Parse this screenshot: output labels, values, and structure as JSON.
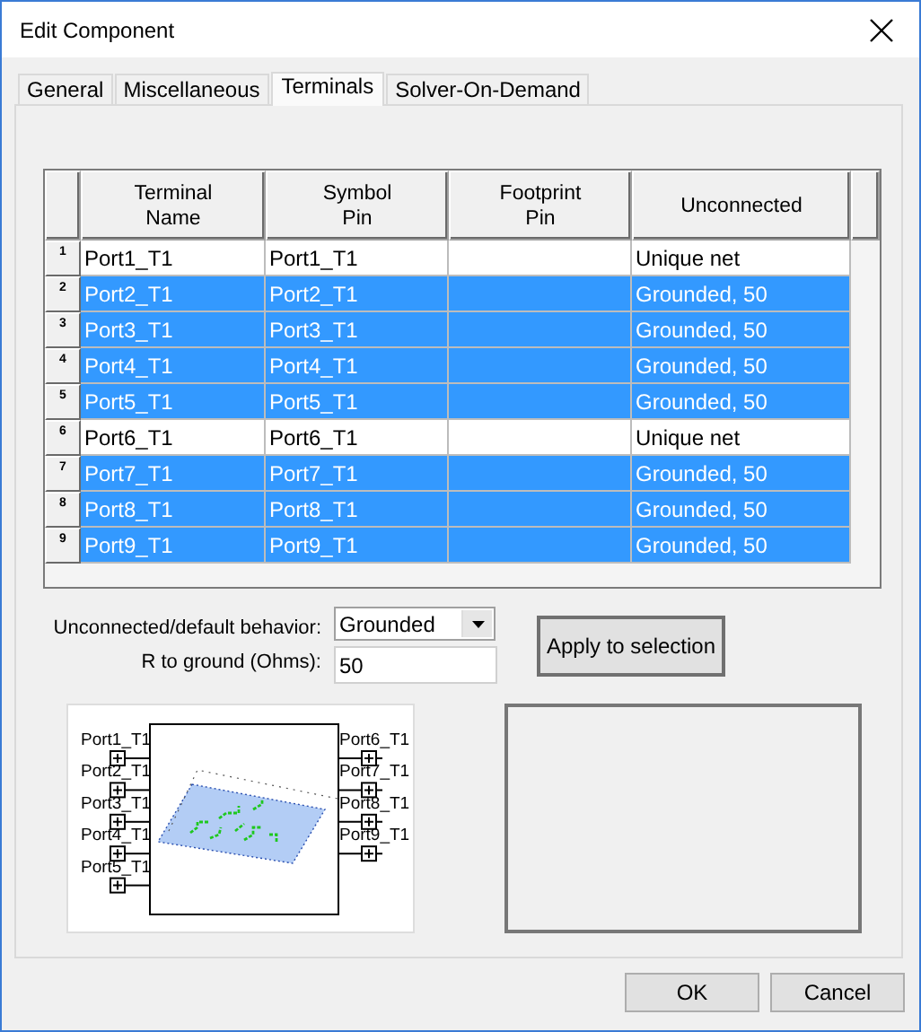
{
  "window": {
    "title": "Edit Component"
  },
  "tabs": [
    {
      "label": "General",
      "selected": false
    },
    {
      "label": "Miscellaneous",
      "selected": false
    },
    {
      "label": "Terminals",
      "selected": true
    },
    {
      "label": "Solver-On-Demand",
      "selected": false
    }
  ],
  "table": {
    "columns": [
      "Terminal\nName",
      "Symbol\nPin",
      "Footprint\nPin",
      "Unconnected"
    ],
    "rows": [
      {
        "number": "1",
        "cells": [
          "Port1_T1",
          "Port1_T1",
          "",
          "Unique net"
        ],
        "selected": false
      },
      {
        "number": "2",
        "cells": [
          "Port2_T1",
          "Port2_T1",
          "",
          "Grounded, 50"
        ],
        "selected": true
      },
      {
        "number": "3",
        "cells": [
          "Port3_T1",
          "Port3_T1",
          "",
          "Grounded, 50"
        ],
        "selected": true
      },
      {
        "number": "4",
        "cells": [
          "Port4_T1",
          "Port4_T1",
          "",
          "Grounded, 50"
        ],
        "selected": true
      },
      {
        "number": "5",
        "cells": [
          "Port5_T1",
          "Port5_T1",
          "",
          "Grounded, 50"
        ],
        "selected": true
      },
      {
        "number": "6",
        "cells": [
          "Port6_T1",
          "Port6_T1",
          "",
          "Unique net"
        ],
        "selected": false
      },
      {
        "number": "7",
        "cells": [
          "Port7_T1",
          "Port7_T1",
          "",
          "Grounded, 50"
        ],
        "selected": true
      },
      {
        "number": "8",
        "cells": [
          "Port8_T1",
          "Port8_T1",
          "",
          "Grounded, 50"
        ],
        "selected": true
      },
      {
        "number": "9",
        "cells": [
          "Port9_T1",
          "Port9_T1",
          "",
          "Grounded, 50"
        ],
        "selected": true
      }
    ]
  },
  "behavior": {
    "label": "Unconnected/default behavior:",
    "value": "Grounded"
  },
  "resistance": {
    "label": "R to ground (Ohms):",
    "value": "50"
  },
  "apply_button": "Apply to selection",
  "preview": {
    "left_ports": [
      "Port1_T1",
      "Port2_T1",
      "Port3_T1",
      "Port4_T1",
      "Port5_T1"
    ],
    "right_ports": [
      "Port6_T1",
      "Port7_T1",
      "Port8_T1",
      "Port9_T1"
    ]
  },
  "buttons": [
    "OK",
    "Cancel"
  ]
}
